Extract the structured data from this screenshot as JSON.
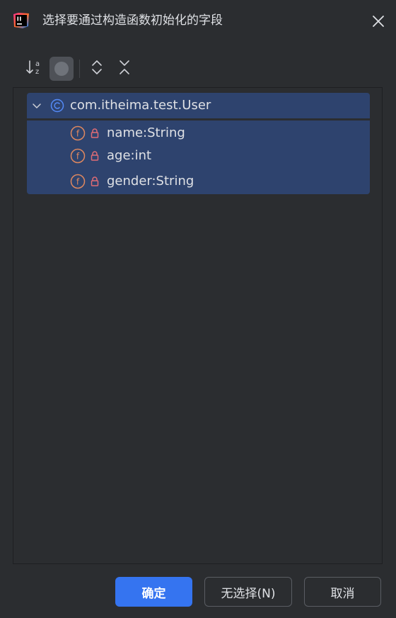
{
  "window": {
    "title": "选择要通过构造函数初始化的字段",
    "app_icon": "jetbrains-logo-icon",
    "close_icon": "close-icon"
  },
  "toolbar": {
    "sort_alpha_icon": "sort-alphabetically-icon",
    "toggle_icon": "show-classes-toggle-icon",
    "expand_all_icon": "expand-all-icon",
    "collapse_all_icon": "collapse-all-icon"
  },
  "tree": {
    "root": {
      "label": "com.itheima.test.User",
      "icon": "class-icon",
      "expanded": true
    },
    "fields": [
      {
        "label": "name:String",
        "icon": "field-icon",
        "access_icon": "lock-icon"
      },
      {
        "label": "age:int",
        "icon": "field-icon",
        "access_icon": "lock-icon"
      },
      {
        "label": "gender:String",
        "icon": "field-icon",
        "access_icon": "lock-icon"
      }
    ]
  },
  "footer": {
    "ok_label": "确定",
    "none_label": "无选择(N)",
    "cancel_label": "取消"
  },
  "colors": {
    "background": "#2b2d30",
    "selection": "#2e436e",
    "accent": "#3574f0",
    "field_icon": "#e0885f",
    "lock_icon": "#e06c75",
    "class_icon": "#548af7"
  }
}
